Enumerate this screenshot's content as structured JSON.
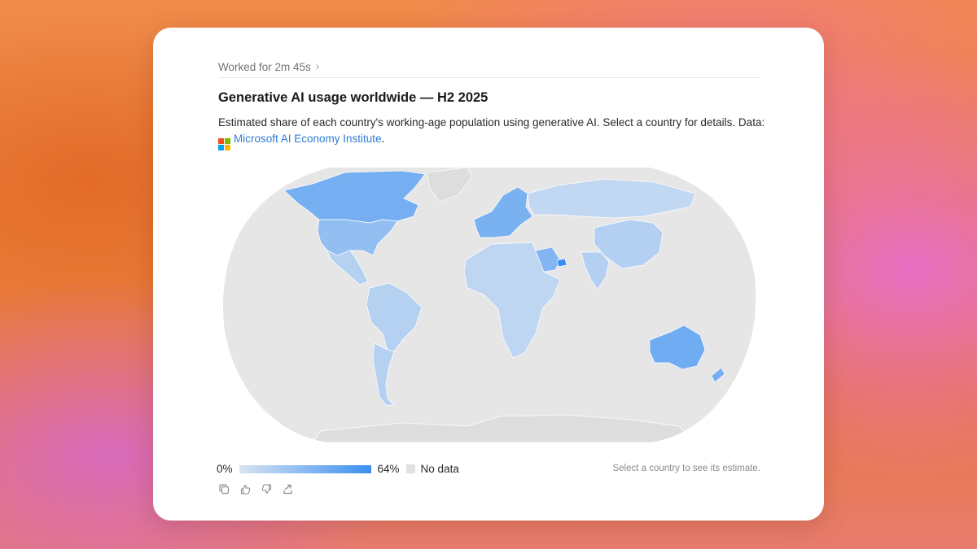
{
  "header": {
    "worked_label": "Worked for 2m 45s",
    "title": "Generative AI usage worldwide — H2 2025",
    "description": "Estimated share of each country's working-age population using generative AI. Select a country for details. Data:",
    "source_link": "Microsoft AI Economy Institute",
    "source_suffix": "."
  },
  "map": {
    "projection": "Robinson-like (rounded world outline)",
    "ocean_color": "#e6e6e6",
    "no_data_color": "#dddddd",
    "scale_min_color": "#d8e3f2",
    "scale_max_color": "#3a8ff0",
    "scale_min_pct": 0,
    "scale_max_pct": 64,
    "regions": [
      {
        "name": "Canada",
        "share_pct": 40
      },
      {
        "name": "United States",
        "share_pct": 28
      },
      {
        "name": "Mexico",
        "share_pct": 14
      },
      {
        "name": "Brazil",
        "share_pct": 14
      },
      {
        "name": "Argentina",
        "share_pct": 14
      },
      {
        "name": "Western Europe",
        "share_pct": 38
      },
      {
        "name": "Russia",
        "share_pct": 9
      },
      {
        "name": "China",
        "share_pct": 15
      },
      {
        "name": "India",
        "share_pct": 15
      },
      {
        "name": "Saudi Arabia",
        "share_pct": 35
      },
      {
        "name": "United Arab Emirates",
        "share_pct": 64
      },
      {
        "name": "Africa",
        "share_pct": 10
      },
      {
        "name": "Australia",
        "share_pct": 42
      },
      {
        "name": "New Zealand",
        "share_pct": 40
      },
      {
        "name": "Greenland",
        "share_pct": null
      },
      {
        "name": "Antarctica",
        "share_pct": null
      }
    ]
  },
  "legend": {
    "min_label": "0%",
    "max_label": "64%",
    "no_data_label": "No data"
  },
  "hint": "Select a country to see its estimate.",
  "actions": {
    "icons": [
      "copy-icon",
      "thumbs-up-icon",
      "thumbs-down-icon",
      "share-icon"
    ]
  }
}
